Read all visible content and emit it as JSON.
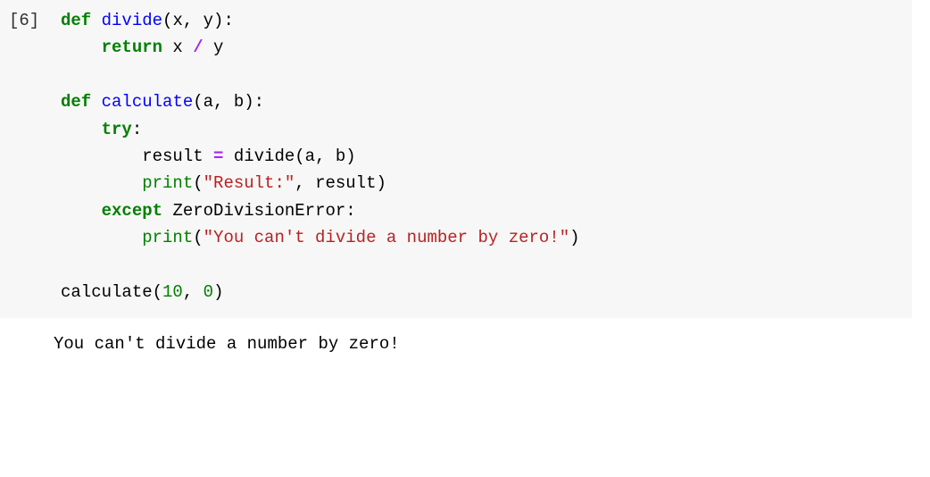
{
  "cell_number": "[6]",
  "code": {
    "kw_def1": "def",
    "fn_divide": "divide",
    "params_divide": "(x, y):",
    "kw_return": "return",
    "expr_return": " x ",
    "op_div": "/",
    "expr_return2": " y",
    "kw_def2": "def",
    "fn_calculate": "calculate",
    "params_calculate": "(a, b):",
    "kw_try": "try",
    "colon1": ":",
    "assign_result": "result ",
    "op_eq": "=",
    "call_divide": " divide(a, b)",
    "print1": "print",
    "print1_open": "(",
    "str_result": "\"Result:\"",
    "print1_rest": ", result)",
    "kw_except": "except",
    "exc_zero": "ZeroDivisionError",
    "colon2": ":",
    "print2": "print",
    "print2_open": "(",
    "str_zero": "\"You can't divide a number by zero!\"",
    "print2_close": ")",
    "call_calc": "calculate(",
    "num_10": "10",
    "comma_sp": ", ",
    "num_0": "0",
    "close_paren": ")"
  },
  "output": "You can't divide a number by zero!"
}
